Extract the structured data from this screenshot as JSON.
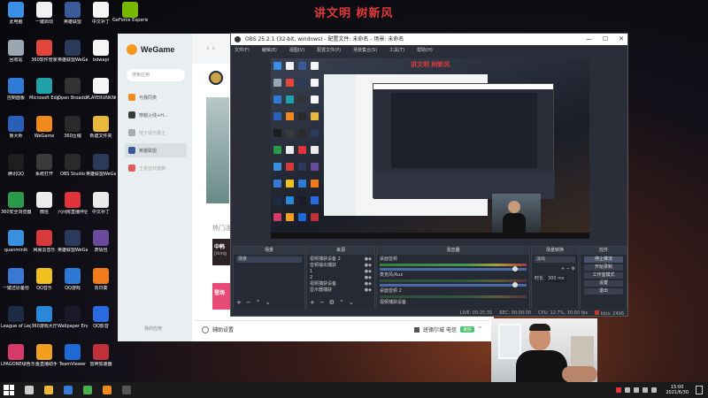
{
  "banner": "讲文明 树新风",
  "desktop_icons": [
    {
      "label": "此电脑",
      "color": "#3a8ee6",
      "col": 0,
      "row": 0
    },
    {
      "label": "一键启动",
      "color": "#f2f2f2",
      "col": 1,
      "row": 0
    },
    {
      "label": "英雄联盟",
      "color": "#3a5a9a",
      "col": 2,
      "row": 0
    },
    {
      "label": "中文补丁",
      "color": "#f5f5f5",
      "col": 3,
      "row": 0
    },
    {
      "label": "回收站",
      "color": "#9aa7b3",
      "col": 0,
      "row": 1
    },
    {
      "label": "360软件管家",
      "color": "#e2463a",
      "col": 1,
      "row": 1
    },
    {
      "label": "英雄联盟WeGame版",
      "color": "#2a3a5a",
      "col": 2,
      "row": 1
    },
    {
      "label": "bdwapi",
      "color": "#f5f5f5",
      "col": 3,
      "row": 1
    },
    {
      "label": "控制面板",
      "color": "#2e7bd6",
      "col": 0,
      "row": 2
    },
    {
      "label": "Microsoft Edge",
      "color": "#1ea1a8",
      "col": 1,
      "row": 2
    },
    {
      "label": "Open Broadcast",
      "color": "#333333",
      "col": 2,
      "row": 2
    },
    {
      "label": "PLAYERUNKNOWN",
      "color": "#f5f5f5",
      "col": 3,
      "row": 2
    },
    {
      "label": "鲁大师",
      "color": "#2a5fb8",
      "col": 0,
      "row": 3
    },
    {
      "label": "WeGame",
      "color": "#f08a1c",
      "col": 1,
      "row": 3
    },
    {
      "label": "360压缩",
      "color": "#2a2a2a",
      "col": 2,
      "row": 3
    },
    {
      "label": "新建文件夹",
      "color": "#e8b93a",
      "col": 3,
      "row": 3
    },
    {
      "label": "腾讯QQ",
      "color": "#1e1e1e",
      "col": 0,
      "row": 4
    },
    {
      "label": "系统打开",
      "color": "#3a3a3a",
      "col": 1,
      "row": 4
    },
    {
      "label": "OBS Studio",
      "color": "#2a2a2a",
      "col": 2,
      "row": 4
    },
    {
      "label": "英雄联盟WeGame版",
      "color": "#2a3a5a",
      "col": 3,
      "row": 4
    },
    {
      "label": "360安全浏览器",
      "color": "#2a9a4a",
      "col": 0,
      "row": 5
    },
    {
      "label": "微信",
      "color": "#ececec",
      "col": 1,
      "row": 5
    },
    {
      "label": "六间房直播伴侣",
      "color": "#e0333a",
      "col": 2,
      "row": 5
    },
    {
      "label": "中文补丁",
      "color": "#eaeaea",
      "col": 3,
      "row": 5
    },
    {
      "label": "quanminlk",
      "color": "#3a90e0",
      "col": 0,
      "row": 6
    },
    {
      "label": "网易云音乐",
      "color": "#d63a3a",
      "col": 1,
      "row": 6
    },
    {
      "label": "英雄联盟WeGame版",
      "color": "#2a3a5a",
      "col": 2,
      "row": 6
    },
    {
      "label": "表情包",
      "color": "#6a4a9a",
      "col": 3,
      "row": 6
    },
    {
      "label": "一键还原备份",
      "color": "#3a78d6",
      "col": 0,
      "row": 7
    },
    {
      "label": "QQ音乐",
      "color": "#f0c020",
      "col": 1,
      "row": 7
    },
    {
      "label": "QQ游戏",
      "color": "#2a7ad6",
      "col": 2,
      "row": 7
    },
    {
      "label": "向日葵",
      "color": "#f07a1c",
      "col": 3,
      "row": 7
    },
    {
      "label": "League of Legends",
      "color": "#1c2a44",
      "col": 0,
      "row": 8
    },
    {
      "label": "360游戏大厅",
      "color": "#2a88d8",
      "col": 1,
      "row": 8
    },
    {
      "label": "Wallpaper Engine",
      "color": "#1a1a2a",
      "col": 2,
      "row": 8
    },
    {
      "label": "QQ影音",
      "color": "#2a6ae0",
      "col": 3,
      "row": 8
    },
    {
      "label": "LPAGONE绿色软件",
      "color": "#d63a6a",
      "col": 0,
      "row": 9
    },
    {
      "label": "乐鱼直播助手",
      "color": "#f0a020",
      "col": 1,
      "row": 9
    },
    {
      "label": "TeamViewer",
      "color": "#1e6ad6",
      "col": 2,
      "row": 9
    },
    {
      "label": "雷神加速器",
      "color": "#c0303a",
      "col": 3,
      "row": 9
    }
  ],
  "extra_icons": [
    {
      "label": "GeForce Experience",
      "color": "#76b900"
    }
  ],
  "wegame": {
    "brand": "WeGame",
    "nav": "‹  ›",
    "search_placeholder": "搜索应用",
    "sidebar": [
      {
        "label": "与我同类",
        "color": "#f08a1c"
      },
      {
        "label": "穿越火线+H...",
        "color": "#3a3a3a"
      },
      {
        "label": "地下城与勇士",
        "color": "#aaaaaa"
      },
      {
        "label": "英雄联盟",
        "color": "#3a5a9a"
      },
      {
        "label": "王者狂欢盛典",
        "color": "#e05a5a"
      }
    ],
    "footer": "我的应用",
    "hot_label": "热门活",
    "card1_title": "中韩",
    "card1_sub": "[iking",
    "card2_title": "登场",
    "recent_label": "近期",
    "bottom_left": "辅助设置",
    "bottom_right": "班德尔城 电信",
    "bottom_badge": "良好",
    "bottom_up": "^"
  },
  "obs": {
    "title": "OBS 25.2.1 (32-bit, windows) - 配置文件: 未命名 - 场景: 未命名",
    "window_controls": [
      "—",
      "☐",
      "✕"
    ],
    "menu": [
      "文件(F)",
      "编辑(E)",
      "视图(V)",
      "配置文件(P)",
      "场景集合(S)",
      "工具(T)",
      "帮助(H)"
    ],
    "preview_banner": "讲文明 树新风",
    "docks": {
      "scenes": {
        "title": "场景",
        "items": [
          "场景"
        ]
      },
      "sources": {
        "title": "来源",
        "items": [
          "视频捕获设备 2",
          "音频输出捕获",
          "1",
          "2",
          "视频捕获设备",
          "显示器捕获"
        ]
      },
      "mixer": {
        "title": "混音器",
        "items": [
          "桌面音频",
          "麦克风/Aux",
          "桌面音频 2",
          "视频捕获设备"
        ]
      },
      "transitions": {
        "title": "场景转换",
        "mode": "淡出",
        "duration_label": "时长",
        "duration": "300 ms"
      },
      "controls": {
        "title": "控件",
        "buttons": [
          "停止推流",
          "开始录制",
          "工作室模式",
          "设置",
          "退出"
        ]
      }
    },
    "status": {
      "live": "LIVE: 00:25:35",
      "rec": "REC: 00:00:00",
      "cpu": "CPU: 12.7%, 30.00 fps",
      "kbps": "kb/s: 2496"
    }
  },
  "taskbar": {
    "apps": [
      {
        "name": "task-view",
        "color": "#cccccc"
      },
      {
        "name": "explorer",
        "color": "#e8b93a"
      },
      {
        "name": "store",
        "color": "#3a78d6"
      },
      {
        "name": "360",
        "color": "#4caf50"
      },
      {
        "name": "wegame",
        "color": "#f08a1c"
      },
      {
        "name": "obs",
        "color": "#555555"
      }
    ],
    "time": "15:00",
    "date": "2021/6/30"
  }
}
